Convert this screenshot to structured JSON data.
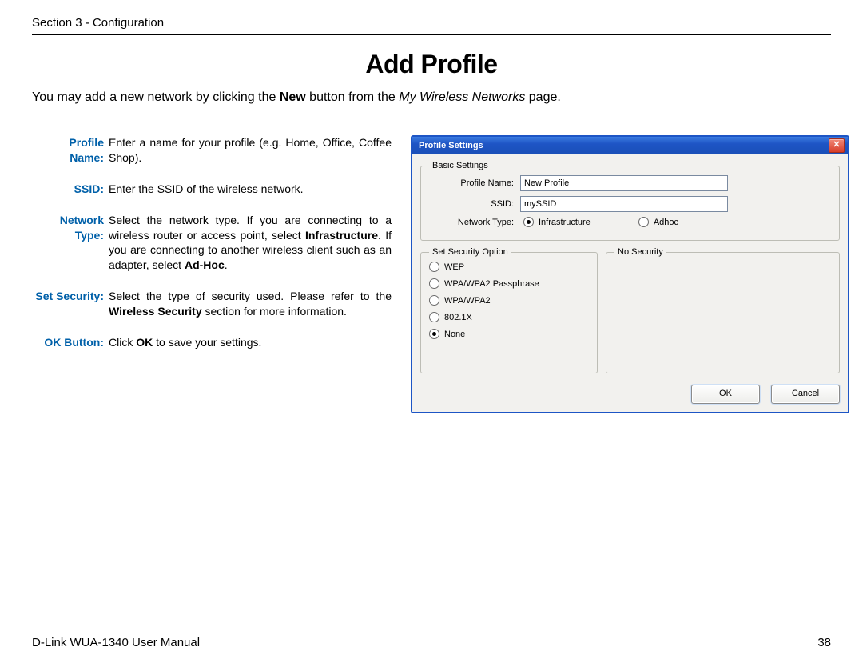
{
  "header": {
    "section": "Section 3 - Configuration"
  },
  "title": "Add Profile",
  "intro": {
    "pre": "You may add a new network by clicking the ",
    "bold": "New",
    "mid": " button from the ",
    "ital": "My Wireless Networks",
    "post": " page."
  },
  "defs": {
    "profile_name": {
      "label": "Profile Name:",
      "text": "Enter a name for your profile (e.g. Home, Office, Coffee Shop)."
    },
    "ssid": {
      "label": "SSID:",
      "text": "Enter the SSID of the wireless network."
    },
    "network_type": {
      "label": "Network Type:",
      "t1": "Select the network type. If you are connecting to a wireless router or access point, select ",
      "b1": "Infrastructure",
      "t2": ". If you are connecting to another wireless client such as an adapter, select ",
      "b2": "Ad-Hoc",
      "t3": "."
    },
    "set_security": {
      "label": "Set Security:",
      "t1": "Select the type of security used. Please refer to the ",
      "b1": "Wireless Security",
      "t2": " section for more information."
    },
    "ok_button": {
      "label": "OK Button:",
      "t1": "Click ",
      "b1": "OK",
      "t2": " to save your settings."
    }
  },
  "dialog": {
    "title": "Profile Settings",
    "basic_legend": "Basic Settings",
    "profile_name_label": "Profile Name:",
    "profile_name_value": "New Profile",
    "ssid_label": "SSID:",
    "ssid_value": "mySSID",
    "network_type_label": "Network Type:",
    "nt_infra": "Infrastructure",
    "nt_adhoc": "Adhoc",
    "sec_legend": "Set Security Option",
    "nosec_legend": "No Security",
    "opt_wep": "WEP",
    "opt_wpawpa2p": "WPA/WPA2 Passphrase",
    "opt_wpawpa2": "WPA/WPA2",
    "opt_8021x": "802.1X",
    "opt_none": "None",
    "ok": "OK",
    "cancel": "Cancel"
  },
  "footer": {
    "left": "D-Link WUA-1340 User Manual",
    "right": "38"
  }
}
